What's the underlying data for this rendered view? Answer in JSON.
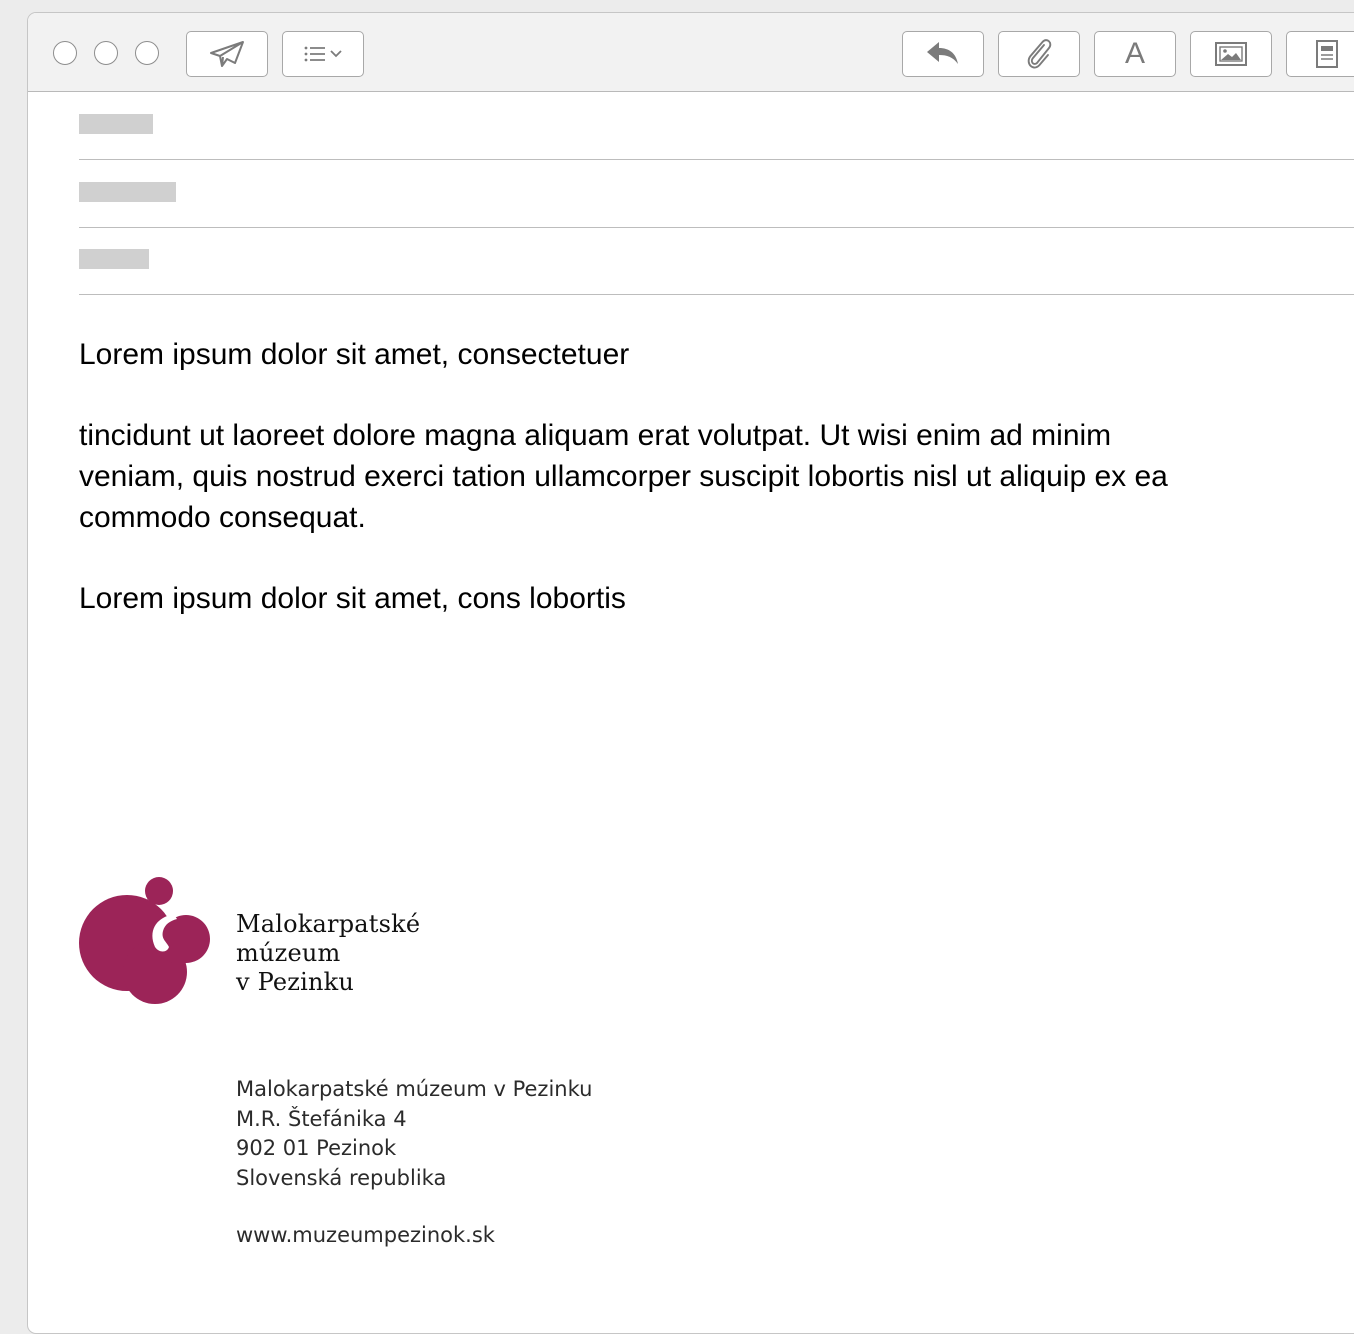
{
  "toolbar": {
    "buttons": [
      {
        "name": "send-button",
        "icon": "paper-plane-icon"
      },
      {
        "name": "format-list-button",
        "icon": "list-icon"
      },
      {
        "name": "reply-button",
        "icon": "reply-arrow-icon"
      },
      {
        "name": "attach-button",
        "icon": "paperclip-icon"
      },
      {
        "name": "font-button",
        "icon": "font-icon",
        "label": "A"
      },
      {
        "name": "photo-browser-button",
        "icon": "image-icon"
      },
      {
        "name": "stationery-button",
        "icon": "document-icon"
      }
    ]
  },
  "message": {
    "paragraphs": [
      "Lorem ipsum dolor sit amet, consectetuer",
      "tincidunt ut laoreet dolore magna aliquam erat volutpat. Ut wisi enim ad minim veniam, quis nostrud exerci tation ullamcorper suscipit lobortis nisl ut aliquip ex ea commodo consequat.",
      "Lorem ipsum dolor sit amet, cons lobortis"
    ]
  },
  "signature": {
    "logo_lines": [
      "Malokarpatské",
      "múzeum",
      "v Pezinku"
    ],
    "address_lines": [
      "Malokarpatské múzeum v Pezinku",
      "M.R. Štefánika 4",
      "902 01 Pezinok",
      "Slovenská republika"
    ],
    "website": "www.muzeumpezinok.sk"
  },
  "colors": {
    "brand": "#9c2458",
    "icon_gray": "#7b7b7b",
    "placeholder": "#d0d0d0"
  }
}
